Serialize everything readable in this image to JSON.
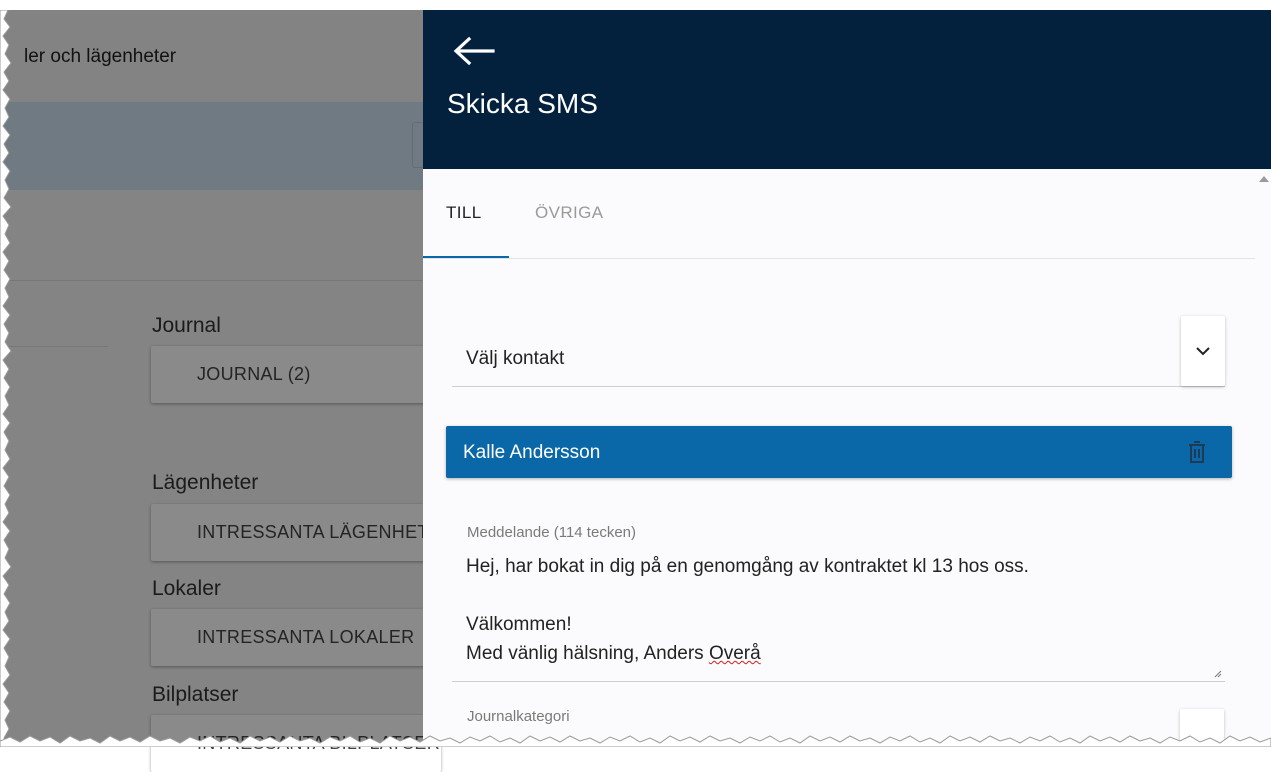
{
  "background": {
    "header_title": "ler och lägenheter",
    "sections": [
      {
        "title": "Journal",
        "button": "JOURNAL (2)"
      },
      {
        "title": "Lägenheter",
        "button": "INTRESSANTA LÄGENHETER"
      },
      {
        "title": "Lokaler",
        "button": "INTRESSANTA LOKALER"
      },
      {
        "title": "Bilplatser",
        "button": "INTRESSANTA BILPLATSER"
      }
    ]
  },
  "drawer": {
    "title": "Skicka SMS",
    "back_icon": "arrow-left-icon",
    "tabs": [
      {
        "label": "TILL",
        "active": true
      },
      {
        "label": "ÖVRIGA",
        "active": false
      }
    ],
    "contact_select": {
      "placeholder": "Välj kontakt",
      "icon": "chevron-down-icon"
    },
    "selected_contact": {
      "name": "Kalle Andersson",
      "icon": "trash-icon"
    },
    "message": {
      "label": "Meddelande (114 tecken)",
      "line1": "Hej, har bokat in dig på en genomgång av kontraktet kl 13 hos oss.",
      "line2": "",
      "line3": "Välkommen!",
      "line4_prefix": "Med vänlig hälsning, Anders ",
      "line4_name": "Overå"
    },
    "journal_category": {
      "label": "Journalkategori"
    }
  },
  "colors": {
    "header_bg": "#03203c",
    "accent": "#0a67a8",
    "drawer_bg": "#fbfbfd"
  }
}
